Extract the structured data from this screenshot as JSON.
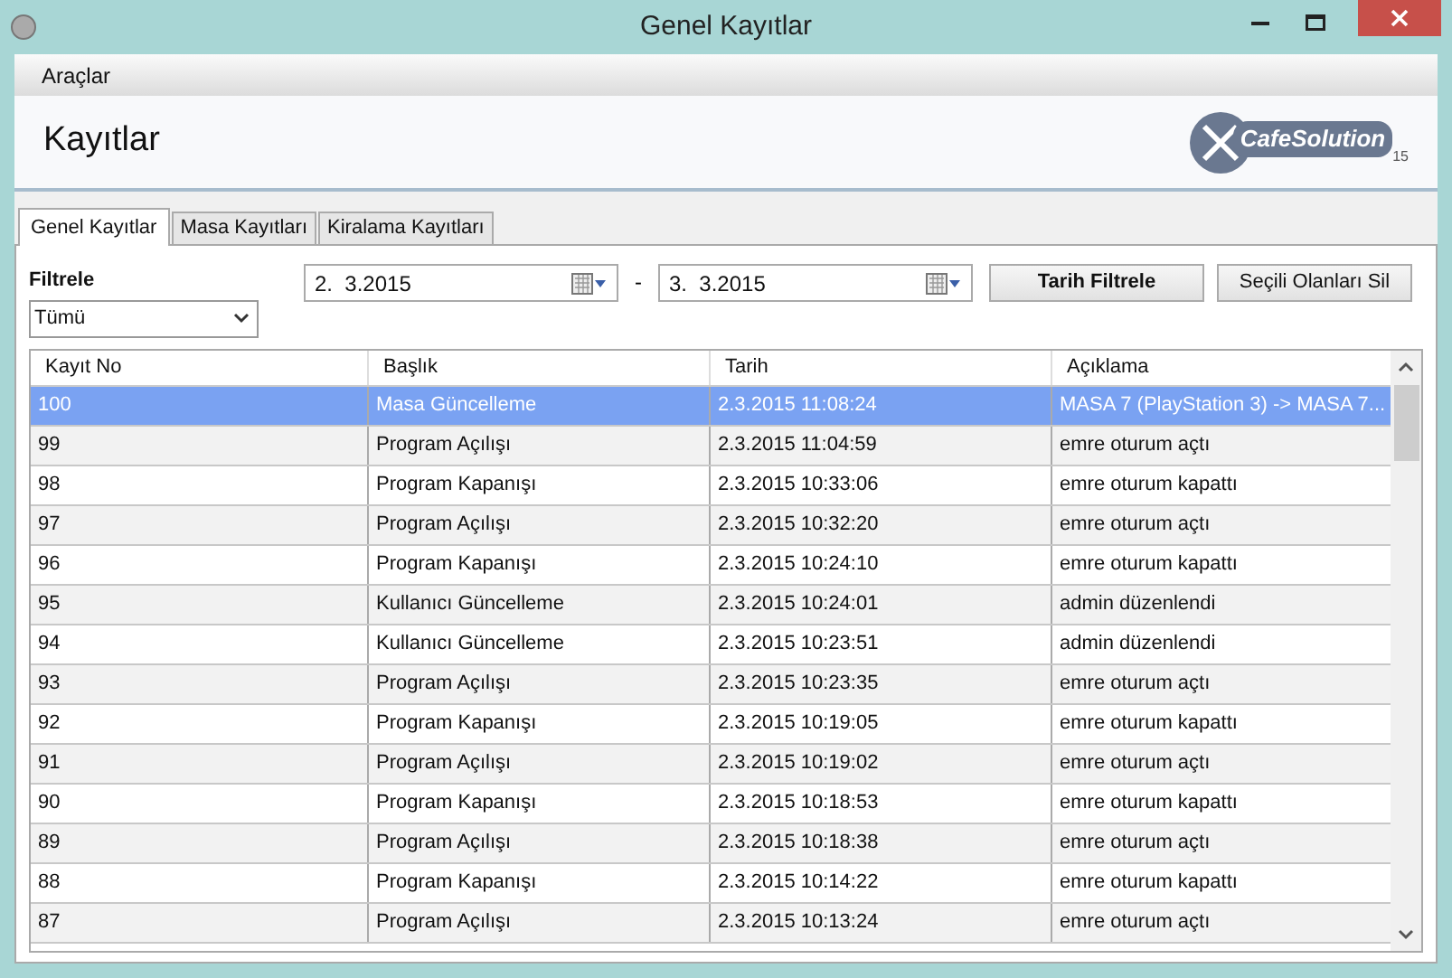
{
  "window": {
    "title": "Genel Kayıtlar"
  },
  "menu": [
    "Araçlar"
  ],
  "header": {
    "title": "Kayıtlar",
    "logo_text": "CafeSolution",
    "logo_version": "15"
  },
  "tabs": [
    {
      "label": "Genel Kayıtlar",
      "selected": true
    },
    {
      "label": "Masa Kayıtları",
      "selected": false
    },
    {
      "label": "Kiralama Kayıtları",
      "selected": false
    }
  ],
  "filter": {
    "label": "Filtrele",
    "value": "Tümü"
  },
  "date_from": "2.  3.2015",
  "separator": "-",
  "date_to": "3.  3.2015",
  "buttons": [
    "Tarih Filtrele",
    "Seçili Olanları Sil"
  ],
  "table": {
    "columns": [
      "Kayıt No",
      "Başlık",
      "Tarih",
      "Açıklama"
    ],
    "rows": [
      {
        "cells": [
          "100",
          "Masa Güncelleme",
          "2.3.2015 11:08:24",
          "MASA 7 (PlayStation 3) -> MASA 7..."
        ],
        "selected": true
      },
      {
        "cells": [
          "99",
          "Program Açılışı",
          "2.3.2015 11:04:59",
          "emre oturum açtı"
        ],
        "selected": false
      },
      {
        "cells": [
          "98",
          "Program Kapanışı",
          "2.3.2015 10:33:06",
          "emre oturum kapattı"
        ],
        "selected": false
      },
      {
        "cells": [
          "97",
          "Program Açılışı",
          "2.3.2015 10:32:20",
          "emre oturum açtı"
        ],
        "selected": false
      },
      {
        "cells": [
          "96",
          "Program Kapanışı",
          "2.3.2015 10:24:10",
          "emre oturum kapattı"
        ],
        "selected": false
      },
      {
        "cells": [
          "95",
          "Kullanıcı Güncelleme",
          "2.3.2015 10:24:01",
          "admin düzenlendi"
        ],
        "selected": false
      },
      {
        "cells": [
          "94",
          "Kullanıcı Güncelleme",
          "2.3.2015 10:23:51",
          "admin düzenlendi"
        ],
        "selected": false
      },
      {
        "cells": [
          "93",
          "Program Açılışı",
          "2.3.2015 10:23:35",
          "emre oturum açtı"
        ],
        "selected": false
      },
      {
        "cells": [
          "92",
          "Program Kapanışı",
          "2.3.2015 10:19:05",
          "emre oturum kapattı"
        ],
        "selected": false
      },
      {
        "cells": [
          "91",
          "Program Açılışı",
          "2.3.2015 10:19:02",
          "emre oturum açtı"
        ],
        "selected": false
      },
      {
        "cells": [
          "90",
          "Program Kapanışı",
          "2.3.2015 10:18:53",
          "emre oturum kapattı"
        ],
        "selected": false
      },
      {
        "cells": [
          "89",
          "Program Açılışı",
          "2.3.2015 10:18:38",
          "emre oturum açtı"
        ],
        "selected": false
      },
      {
        "cells": [
          "88",
          "Program Kapanışı",
          "2.3.2015 10:14:22",
          "emre oturum kapattı"
        ],
        "selected": false
      },
      {
        "cells": [
          "87",
          "Program Açılışı",
          "2.3.2015 10:13:24",
          "emre oturum açtı"
        ],
        "selected": false
      }
    ]
  }
}
